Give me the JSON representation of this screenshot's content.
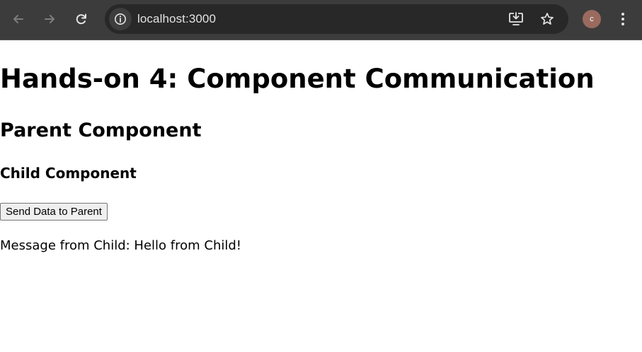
{
  "browser": {
    "url": "localhost:3000",
    "profile_initial": "c",
    "icons": {
      "back": "arrow-left-icon",
      "forward": "arrow-right-icon",
      "reload": "reload-icon",
      "site_info": "info-icon",
      "install": "install-app-icon",
      "bookmark": "star-icon",
      "menu": "more-vert-icon"
    },
    "colors": {
      "toolbar": "#3c3c3c",
      "omnibox": "#282828",
      "avatar": "#9a6a5f"
    }
  },
  "page": {
    "title": "Hands-on 4: Component Communication",
    "parent_heading": "Parent Component",
    "child_heading": "Child Component",
    "send_button_label": "Send Data to Parent",
    "message": "Message from Child: Hello from Child!"
  }
}
